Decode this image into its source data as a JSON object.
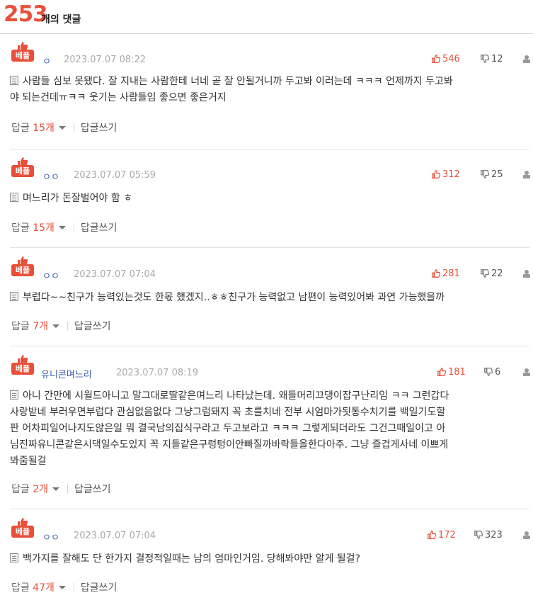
{
  "header": {
    "count": "253",
    "label": "개의 댓글"
  },
  "best_badge_label": "베플",
  "reply_label": "답글",
  "write_reply_label": "답글쓰기",
  "colors": {
    "accent": "#e8503a",
    "nick": "#3b5bab",
    "meta": "#aaaaaa"
  },
  "comments": [
    {
      "nick": "ㅇ",
      "date": "2023.07.07 08:22",
      "likes": "546",
      "dislikes": "12",
      "lines": [
        "사람들 심보 못됐다. 잘 지내는 사람한테 너네 곧 잘 안될거니까 두고봐 이러는데 ㅋㅋㅋ 언제까지 두고봐",
        "야 되는건데ㅠㅋㅋ 웃기는 사람들임 좋으면 좋은거지"
      ],
      "reply_count": "15개"
    },
    {
      "nick": "ㅇㅇ",
      "date": "2023.07.07 05:59",
      "likes": "312",
      "dislikes": "25",
      "lines": [
        "며느리가 돈잘벌어야 함 ㅎ"
      ],
      "reply_count": "15개"
    },
    {
      "nick": "ㅇㅇ",
      "date": "2023.07.07 07:04",
      "likes": "281",
      "dislikes": "22",
      "lines": [
        "부럽다~~친구가 능력있는것도 한몫 했겠지..ㅎㅎ친구가 능력없고 남편이 능력있어봐 과연 가능했을까"
      ],
      "reply_count": "7개"
    },
    {
      "nick": "유니콘며느리",
      "date": "2023.07.07 08:19",
      "likes": "181",
      "dislikes": "6",
      "lines": [
        "아니 간만에 시월드아니고 말그대로딸같은며느리 나타났는데. 왜들머리끄댕이잡구난리임 ㅋㅋ 그런갑다",
        "사랑받네 부러우면부럽다 관심없음없다 그냥그럼돼지 꼭 초를치네 전부 시엄마가됫통수치기를 백일기도할",
        "판 어차피일어나지도않은일 뭐 결국남의집식구라고 두고보라고 ㅋㅋㅋ 그렇게되더라도 그건그때일이고 아",
        "님진짜유니콘같은시댁일수도있지 꼭 지들같은구렁텅이안빠질까바락들을한다아주. 그냥 즐겁게사네 이쁘게",
        "봐줌될걸"
      ],
      "reply_count": "2개"
    },
    {
      "nick": "ㅇㅇ",
      "date": "2023.07.07 07:04",
      "likes": "172",
      "dislikes": "323",
      "lines": [
        "백가지를 잘해도 단 한가지 결정적일때는 남의 엄마인거임. 당해봐야만 알게 될걸?"
      ],
      "reply_count": "47개"
    }
  ]
}
